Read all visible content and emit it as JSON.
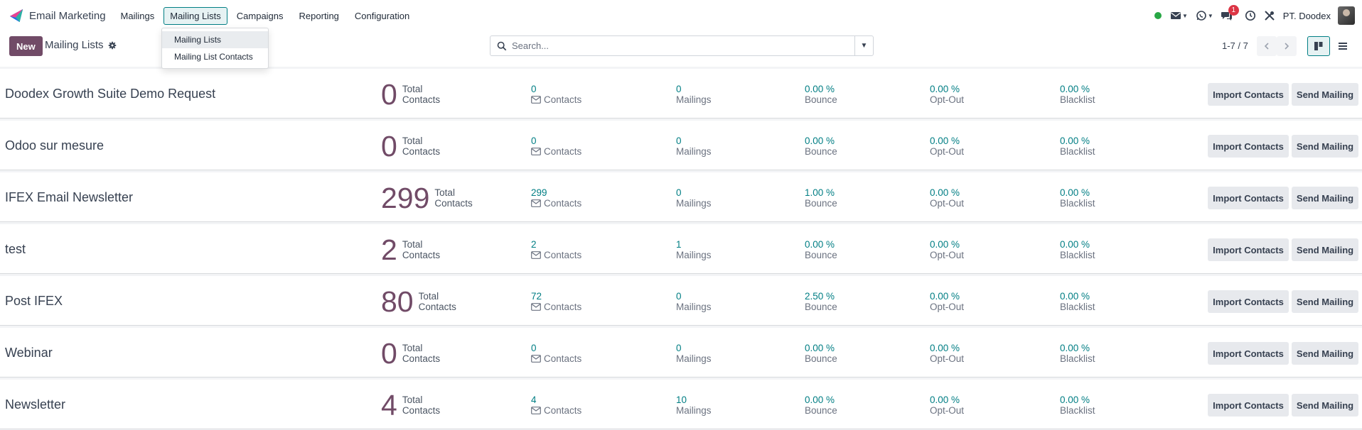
{
  "app": {
    "name": "Email Marketing"
  },
  "menus": [
    {
      "label": "Mailings",
      "active": false
    },
    {
      "label": "Mailing Lists",
      "active": true
    },
    {
      "label": "Campaigns",
      "active": false
    },
    {
      "label": "Reporting",
      "active": false
    },
    {
      "label": "Configuration",
      "active": false
    }
  ],
  "systray": {
    "company": "PT. Doodex",
    "message_count": "1"
  },
  "control": {
    "new_label": "New",
    "breadcrumb": "Mailing Lists",
    "search_placeholder": "Search...",
    "pager": "1-7 / 7"
  },
  "dropdown": {
    "items": [
      {
        "label": "Mailing Lists",
        "hovered": true
      },
      {
        "label": "Mailing List Contacts",
        "hovered": false
      }
    ]
  },
  "labels": {
    "total": "Total",
    "contacts": "Contacts",
    "mailings": "Mailings",
    "bounce": "Bounce",
    "optout": "Opt-Out",
    "blacklist": "Blacklist",
    "import_btn": "Import Contacts",
    "send_btn": "Send Mailing"
  },
  "lists": [
    {
      "name": "Doodex Growth Suite Demo Request",
      "total": "0",
      "contacts": "0",
      "mailings": "0",
      "bounce": "0.00 %",
      "optout": "0.00 %",
      "blacklist": "0.00 %"
    },
    {
      "name": "Odoo sur mesure",
      "total": "0",
      "contacts": "0",
      "mailings": "0",
      "bounce": "0.00 %",
      "optout": "0.00 %",
      "blacklist": "0.00 %"
    },
    {
      "name": "IFEX Email Newsletter",
      "total": "299",
      "contacts": "299",
      "mailings": "0",
      "bounce": "1.00 %",
      "optout": "0.00 %",
      "blacklist": "0.00 %"
    },
    {
      "name": "test",
      "total": "2",
      "contacts": "2",
      "mailings": "1",
      "bounce": "0.00 %",
      "optout": "0.00 %",
      "blacklist": "0.00 %"
    },
    {
      "name": "Post IFEX",
      "total": "80",
      "contacts": "72",
      "mailings": "0",
      "bounce": "2.50 %",
      "optout": "0.00 %",
      "blacklist": "0.00 %"
    },
    {
      "name": "Webinar",
      "total": "0",
      "contacts": "0",
      "mailings": "0",
      "bounce": "0.00 %",
      "optout": "0.00 %",
      "blacklist": "0.00 %"
    },
    {
      "name": "Newsletter",
      "total": "4",
      "contacts": "4",
      "mailings": "10",
      "bounce": "0.00 %",
      "optout": "0.00 %",
      "blacklist": "0.00 %"
    }
  ],
  "colors": {
    "brand": "#714b67",
    "accent": "#017e84"
  }
}
